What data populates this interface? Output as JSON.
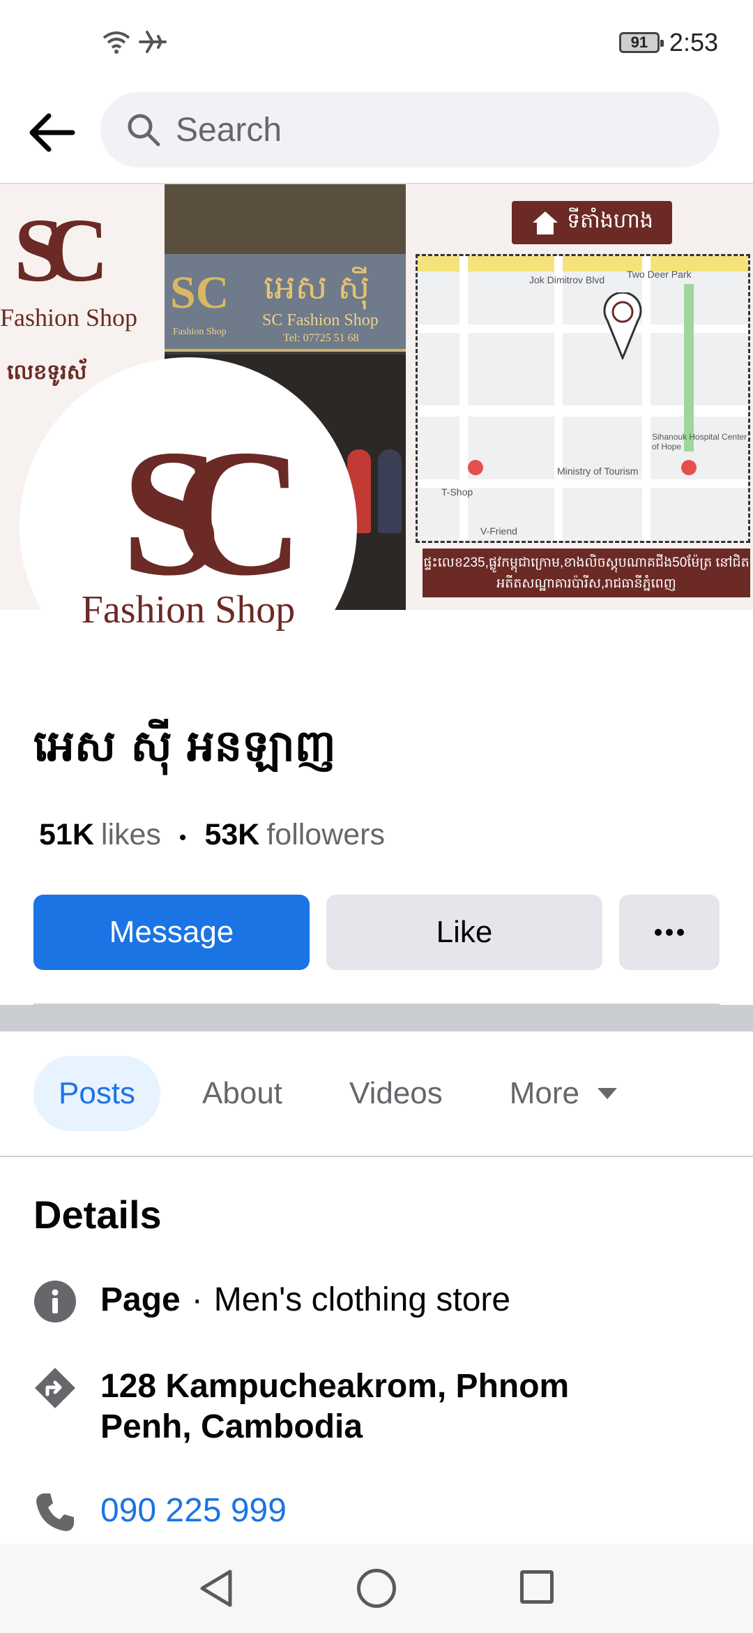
{
  "status_bar": {
    "battery": "91",
    "time": "2:53",
    "icons": [
      "wifi-icon",
      "airplane-icon"
    ]
  },
  "top_bar": {
    "search_placeholder": "Search",
    "icons": [
      "back-arrow-icon",
      "search-icon"
    ]
  },
  "cover": {
    "sc_mark": "SC",
    "fashion_text": "Fashion Shop",
    "phone_label": "លេខទូរស័",
    "sign_khmer": "អេស ស៊ី",
    "sign_english": "SC Fashion Shop",
    "sign_small_left": "Fashion Shop",
    "sign_small_right": "Tel: 07725 51 68",
    "map_title": "ទីតាំងហាង",
    "map_street_1": "Jok Dimitrov Blvd",
    "map_street_2": "Two Deer Park",
    "map_label_ministry": "Ministry of Tourism",
    "map_label_center": "Sihanouk Hospital Center of Hope",
    "map_label_tshop": "T-Shop",
    "map_label_vfriend": "V-Friend",
    "map_footer": "ផ្ទះលេខ235,ផ្លូវកម្ពុជាក្រោម,ខាងលិចស្តុបណាគជីង50ម៉ែត្រ នៅជិតអតីតសណ្ឋាគារប៉ារីស,រាជធានីភ្នំពេញ"
  },
  "profile": {
    "logo_text": "SC",
    "logo_subtitle": "Fashion Shop"
  },
  "page": {
    "name": "អេស ស៊ី អនឡាញ",
    "likes_count": "51K",
    "likes_label": "likes",
    "followers_count": "53K",
    "followers_label": "followers"
  },
  "actions": {
    "message": "Message",
    "like": "Like"
  },
  "tabs": {
    "posts": "Posts",
    "about": "About",
    "videos": "Videos",
    "more": "More"
  },
  "details": {
    "title": "Details",
    "page_label": "Page",
    "category": "Men's clothing store",
    "address": "128 Kampucheakrom, Phnom Penh, Cambodia",
    "phone": "090 225 999"
  },
  "colors": {
    "accent": "#1b74e4",
    "brand": "#6b2a25",
    "secondary_text": "#65676b"
  }
}
